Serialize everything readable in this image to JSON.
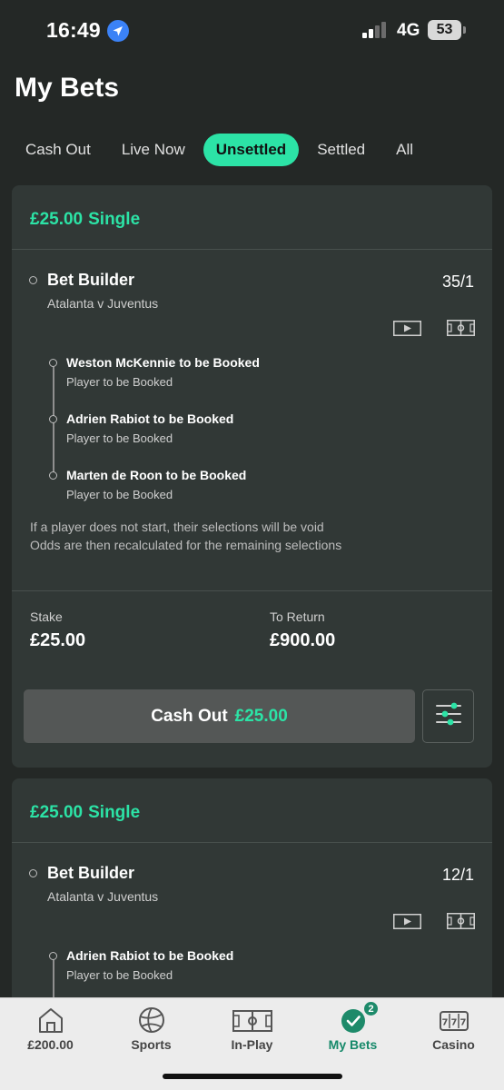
{
  "status_bar": {
    "time": "16:49",
    "network": "4G",
    "battery": "53"
  },
  "page_title": "My Bets",
  "tabs": [
    {
      "label": "Cash Out"
    },
    {
      "label": "Live Now"
    },
    {
      "label": "Unsettled",
      "active": true
    },
    {
      "label": "Settled"
    },
    {
      "label": "All"
    }
  ],
  "bets": [
    {
      "stake_header": "£25.00",
      "bet_type": "Single",
      "builder_title": "Bet Builder",
      "match": "Atalanta v Juventus",
      "odds": "35/1",
      "selections": [
        {
          "name": "Weston McKennie to be Booked",
          "market": "Player to be Booked"
        },
        {
          "name": "Adrien Rabiot to be Booked",
          "market": "Player to be Booked"
        },
        {
          "name": "Marten de Roon to be Booked",
          "market": "Player to be Booked"
        }
      ],
      "note_line1": "If a player does not start, their selections will be void",
      "note_line2": "Odds are then recalculated for the remaining selections",
      "stake_label": "Stake",
      "stake_value": "£25.00",
      "return_label": "To Return",
      "return_value": "£900.00",
      "cashout_label": "Cash Out",
      "cashout_amount": "£25.00"
    },
    {
      "stake_header": "£25.00",
      "bet_type": "Single",
      "builder_title": "Bet Builder",
      "match": "Atalanta v Juventus",
      "odds": "12/1",
      "selections": [
        {
          "name": "Adrien Rabiot to be Booked",
          "market": "Player to be Booked"
        }
      ]
    }
  ],
  "bottom_nav": [
    {
      "label": "£200.00",
      "icon": "home-icon"
    },
    {
      "label": "Sports",
      "icon": "football-icon"
    },
    {
      "label": "In-Play",
      "icon": "pitch-icon"
    },
    {
      "label": "My Bets",
      "icon": "check-circle-icon",
      "badge": "2",
      "active": true
    },
    {
      "label": "Casino",
      "icon": "slot-machine-icon"
    }
  ],
  "colors": {
    "accent": "#2ce3a6",
    "background": "#242826",
    "card": "#313836",
    "nav_active": "#16896a"
  }
}
